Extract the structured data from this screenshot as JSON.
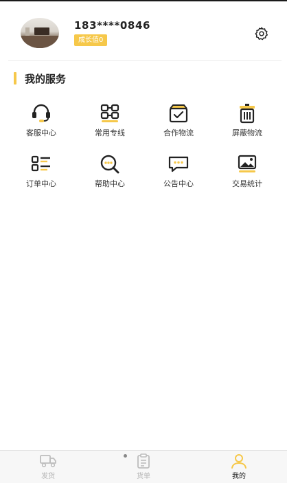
{
  "profile": {
    "phone": "183****0846",
    "growth_badge": "成长值0"
  },
  "services": {
    "title": "我的服务",
    "items": [
      {
        "label": "客服中心",
        "icon": "headset-icon"
      },
      {
        "label": "常用专线",
        "icon": "route-link-icon"
      },
      {
        "label": "合作物流",
        "icon": "partner-box-icon"
      },
      {
        "label": "屏蔽物流",
        "icon": "trash-bin-icon"
      },
      {
        "label": "订单中心",
        "icon": "order-list-icon"
      },
      {
        "label": "帮助中心",
        "icon": "help-search-icon"
      },
      {
        "label": "公告中心",
        "icon": "announcement-chat-icon"
      },
      {
        "label": "交易统计",
        "icon": "stats-image-icon"
      }
    ]
  },
  "tabbar": {
    "tabs": [
      {
        "label": "发货",
        "icon": "truck-icon",
        "active": false
      },
      {
        "label": "货单",
        "icon": "clipboard-icon",
        "active": false
      },
      {
        "label": "我的",
        "icon": "user-icon",
        "active": true
      }
    ]
  },
  "colors": {
    "accent": "#f6c84a",
    "icon_dark": "#222222",
    "inactive": "#b5b5b5"
  }
}
